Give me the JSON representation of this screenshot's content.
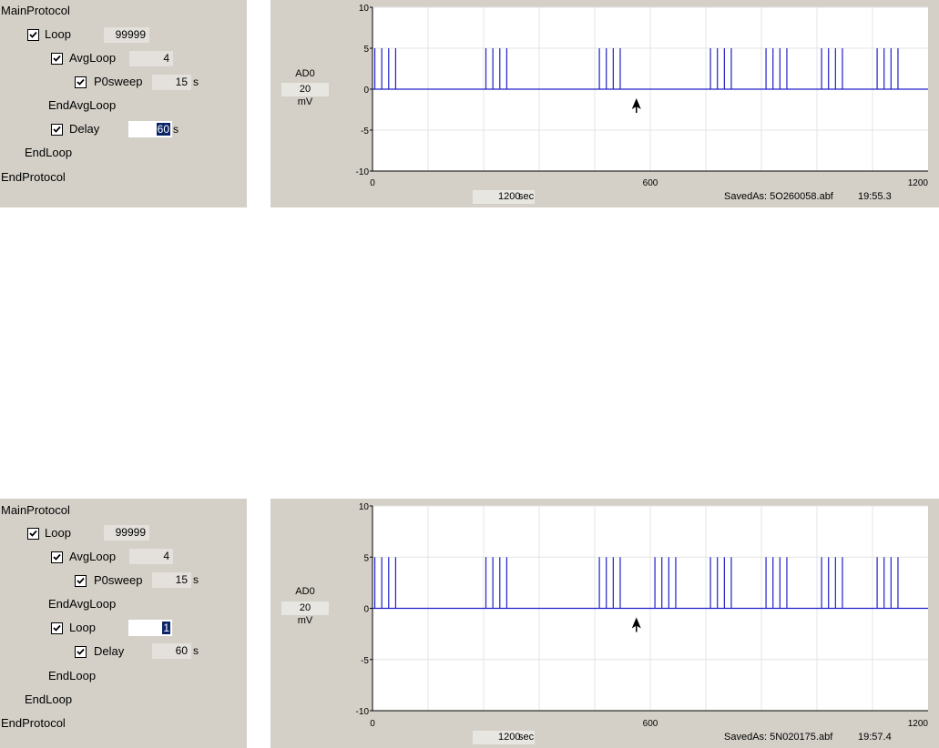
{
  "panels": [
    {
      "protocol": {
        "main": "MainProtocol",
        "loop_label": "Loop",
        "loop_value": "99999",
        "avgloop_label": "AvgLoop",
        "avgloop_value": "4",
        "p0sweep_label": "P0sweep",
        "p0sweep_value": "15",
        "p0sweep_unit": "s",
        "endavgloop": "EndAvgLoop",
        "delay_label": "Delay",
        "delay_value": "60",
        "delay_unit": "s",
        "endloop": "EndLoop",
        "endprotocol": "EndProtocol"
      },
      "scope": {
        "channel": "AD0",
        "scale": "20",
        "unit": "mV",
        "duration": "1200",
        "duration_unit": "sec",
        "saved_as": "SavedAs: 5O260058.abf",
        "time": "19:55.3"
      }
    },
    {
      "protocol": {
        "main": "MainProtocol",
        "loop_label": "Loop",
        "loop_value": "99999",
        "avgloop_label": "AvgLoop",
        "avgloop_value": "4",
        "p0sweep_label": "P0sweep",
        "p0sweep_value": "15",
        "p0sweep_unit": "s",
        "endavgloop": "EndAvgLoop",
        "inner_loop_label": "Loop",
        "inner_loop_value": "1",
        "delay_label": "Delay",
        "delay_value": "60",
        "delay_unit": "s",
        "endloop_inner": "EndLoop",
        "endloop": "EndLoop",
        "endprotocol": "EndProtocol"
      },
      "scope": {
        "channel": "AD0",
        "scale": "20",
        "unit": "mV",
        "duration": "1200",
        "duration_unit": "sec",
        "saved_as": "SavedAs: 5N020175.abf",
        "time": "19:57.4"
      }
    }
  ],
  "chart_data": [
    {
      "type": "line",
      "xlim": [
        0,
        1200
      ],
      "ylim": [
        -10,
        10
      ],
      "x_ticks": [
        "0",
        "600",
        "1200"
      ],
      "y_ticks": [
        "10",
        "5",
        "0",
        "-5",
        "-10"
      ],
      "baseline": 0,
      "pulse_amplitude": 5,
      "pulse_times": [
        5,
        20,
        35,
        50,
        245,
        260,
        275,
        290,
        490,
        505,
        520,
        535,
        730,
        745,
        760,
        775,
        850,
        865,
        880,
        895,
        970,
        985,
        1000,
        1015,
        1090,
        1105,
        1120,
        1135
      ],
      "marker_x": 570,
      "line_color": "#2020c8"
    },
    {
      "type": "line",
      "xlim": [
        0,
        1200
      ],
      "ylim": [
        -10,
        10
      ],
      "x_ticks": [
        "0",
        "600",
        "1200"
      ],
      "y_ticks": [
        "10",
        "5",
        "0",
        "-5",
        "-10"
      ],
      "baseline": 0,
      "pulse_amplitude": 5,
      "pulse_times": [
        5,
        20,
        35,
        50,
        245,
        260,
        275,
        290,
        490,
        505,
        520,
        535,
        610,
        625,
        640,
        655,
        730,
        745,
        760,
        775,
        850,
        865,
        880,
        895,
        970,
        985,
        1000,
        1015,
        1090,
        1105,
        1120,
        1135
      ],
      "marker_x": 570,
      "line_color": "#2020c8"
    }
  ]
}
